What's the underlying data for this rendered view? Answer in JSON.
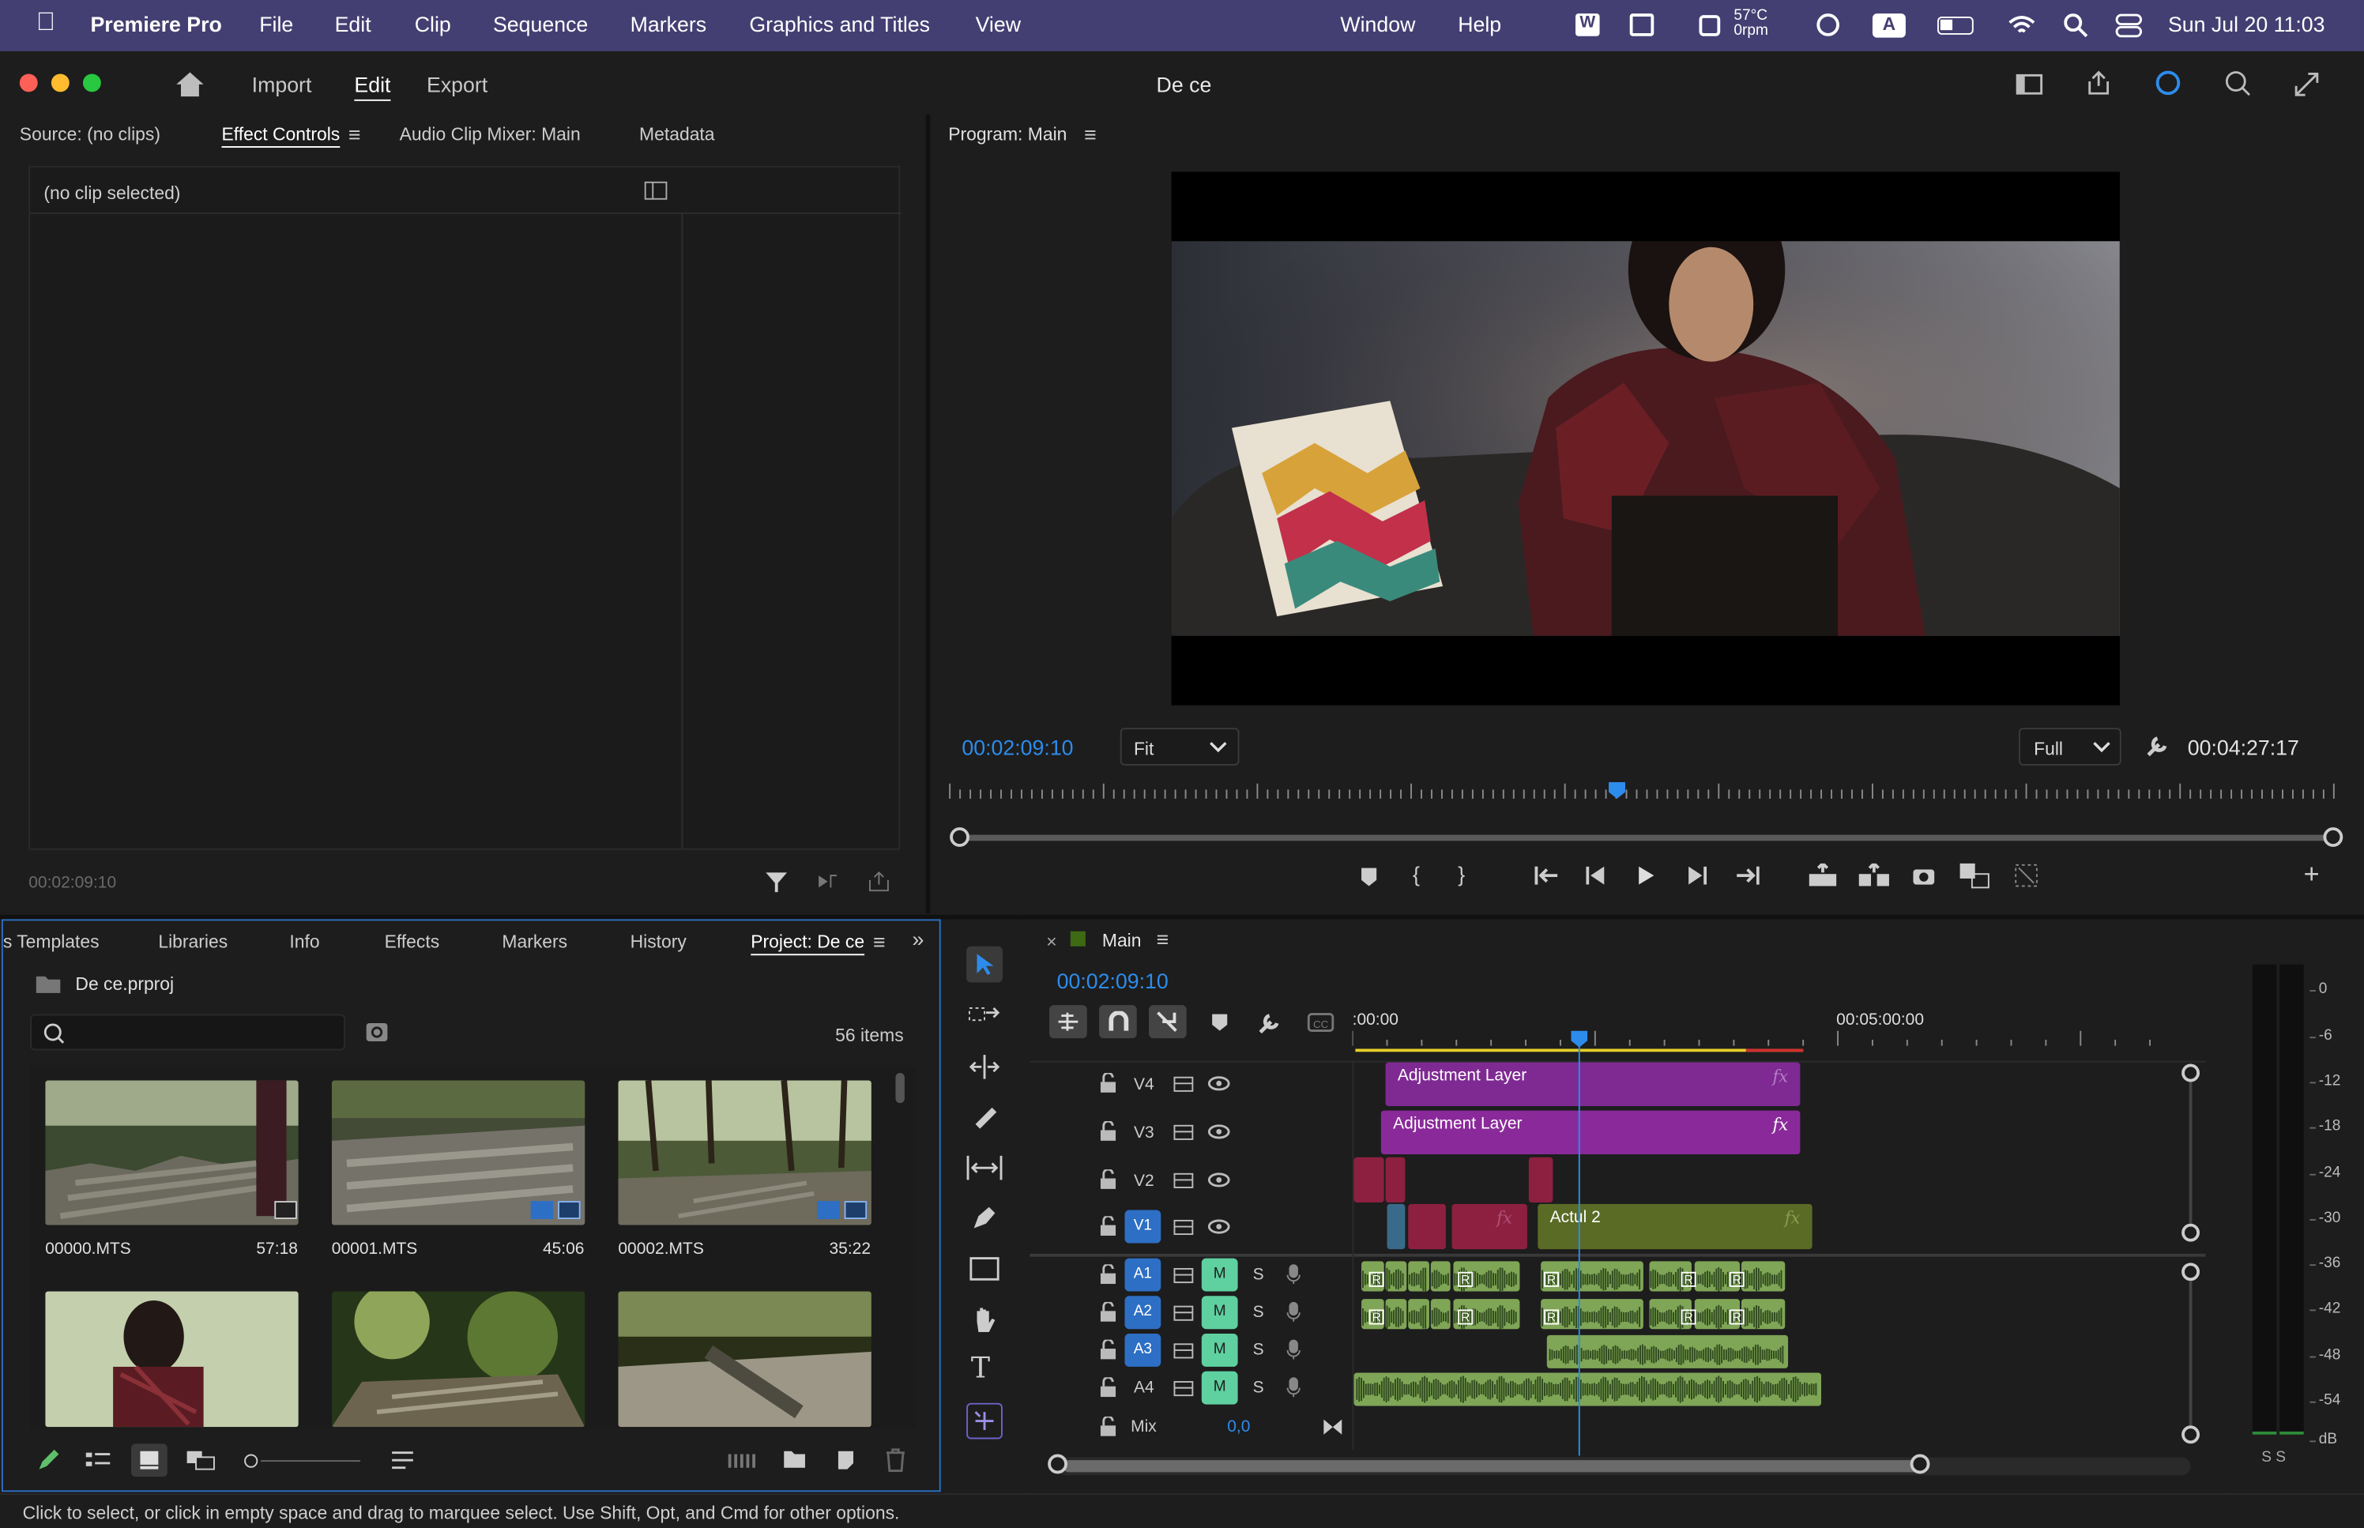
{
  "menubar": {
    "app": "Premiere Pro",
    "items": [
      "File",
      "Edit",
      "Clip",
      "Sequence",
      "Markers",
      "Graphics and Titles",
      "View"
    ],
    "window": "Window",
    "help": "Help",
    "weather": "57°C",
    "weather_sub": "0rpm",
    "datetime": "Sun Jul 20  11:03"
  },
  "titlebar": {
    "tabs": [
      "Import",
      "Edit",
      "Export"
    ],
    "title": "De ce"
  },
  "source_panel": {
    "tabs": [
      "Source: (no clips)",
      "Effect Controls",
      "Audio Clip Mixer: Main",
      "Metadata"
    ],
    "no_clip": "(no clip selected)",
    "timecode": "00:02:09:10"
  },
  "program": {
    "label": "Program: Main",
    "timecode": "00:02:09:10",
    "fit": "Fit",
    "quality": "Full",
    "duration": "00:04:27:17"
  },
  "project": {
    "tabs": [
      "s Templates",
      "Libraries",
      "Info",
      "Effects",
      "Markers",
      "History",
      "Project: De ce"
    ],
    "file": "De ce.prproj",
    "search_placeholder": "",
    "items_count": "56 items",
    "clips": [
      {
        "name": "00000.MTS",
        "duration": "57:18"
      },
      {
        "name": "00001.MTS",
        "duration": "45:06"
      },
      {
        "name": "00002.MTS",
        "duration": "35:22"
      },
      {
        "name": "",
        "duration": ""
      },
      {
        "name": "",
        "duration": ""
      },
      {
        "name": "",
        "duration": ""
      }
    ]
  },
  "timeline": {
    "tab": "Main",
    "timecode": "00:02:09:10",
    "ruler_start": ":00:00",
    "ruler_mid": "00:05:00:00",
    "video_tracks": [
      "V4",
      "V3",
      "V2",
      "V1"
    ],
    "audio_tracks": [
      "A1",
      "A2",
      "A3",
      "A4"
    ],
    "mix_label": "Mix",
    "mix_value": "0,0",
    "mute": "M",
    "solo": "S",
    "clips": {
      "adj1": "Adjustment Layer",
      "adj2": "Adjustment Layer",
      "actul": "Actul 2",
      "fx": "fx",
      "r": "R"
    }
  },
  "meter": {
    "scale": [
      "0",
      "-6",
      "-12",
      "-18",
      "-24",
      "-30",
      "-36",
      "-42",
      "-48",
      "-54",
      "dB"
    ],
    "solo": "S  S"
  },
  "status": "Click to select, or click in empty space and drag to marquee select. Use Shift, Opt, and Cmd for other options.",
  "colors": {
    "accent": "#2d8ceb",
    "menubar": "#443f72",
    "adjustment": "#8a2a9a",
    "v1clip": "#5a6b25",
    "audio": "#7fa556"
  }
}
